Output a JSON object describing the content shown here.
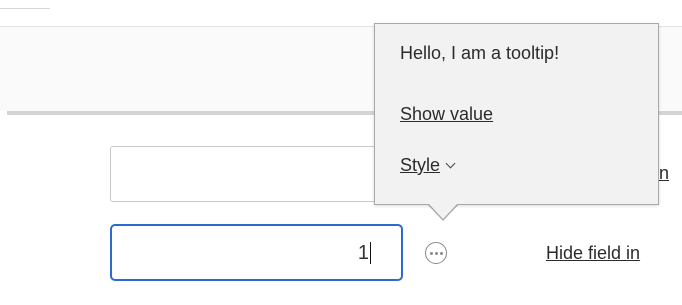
{
  "form": {
    "field_1_value": "",
    "field_2_value": "1",
    "link_behind_text": "in",
    "hide_field_link": "Hide field in"
  },
  "tooltip": {
    "text": "Hello, I am a tooltip!",
    "show_value_link": "Show value",
    "style_link": "Style"
  },
  "icons": {
    "more": "ellipsis-circle-icon",
    "chevron": "chevron-down-icon"
  },
  "colors": {
    "focus_border": "#2a6ad2",
    "tooltip_bg": "#f2f2f2",
    "tooltip_border": "#a9a9a9"
  }
}
